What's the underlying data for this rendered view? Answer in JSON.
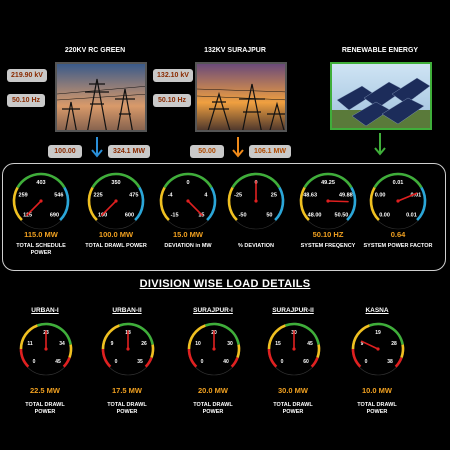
{
  "sources": [
    {
      "title": "220KV RC GREEN",
      "voltage": "219.90 kV",
      "frequency": "50.10 Hz",
      "flow_left": "100.00",
      "flow_right": "324.1 MW",
      "arrow_color": "#2a8fd8"
    },
    {
      "title": "132KV SURAJPUR",
      "voltage": "132.10 kV",
      "frequency": "50.10 Hz",
      "flow_left": "50.00",
      "flow_right": "106.1 MW",
      "arrow_color": "#f08a1a"
    },
    {
      "title": "RENEWABLE ENERGY",
      "arrow_color": "#3fae3a"
    }
  ],
  "summary_gauges": [
    {
      "ticks": [
        "403",
        "259",
        "546",
        "115",
        "690"
      ],
      "value": "115.0 MW",
      "label": "TOTAL SCHEDULE POWER",
      "fraction": 0.0
    },
    {
      "ticks": [
        "350",
        "225",
        "475",
        "100",
        "600"
      ],
      "value": "100.0 MW",
      "label": "TOTAL DRAWL POWER",
      "fraction": 0.0
    },
    {
      "ticks": [
        "0",
        "-4",
        "4",
        "-15",
        "15"
      ],
      "value": "15.0 MW",
      "label": "DEVIATION in MW",
      "fraction": 1.0
    },
    {
      "ticks": [
        "0",
        "-25",
        "25",
        "-50",
        "50"
      ],
      "value": "",
      "label": "% DEVIATION",
      "fraction": 0.5
    },
    {
      "ticks": [
        "49.25",
        "48.63",
        "49.88",
        "48.00",
        "50.50"
      ],
      "value": "50.10 HZ",
      "label": "SYSTEM FREQENCY",
      "fraction": 0.84
    },
    {
      "ticks": [
        "0.01",
        "0.00",
        "0.01",
        "0.00",
        "0.01"
      ],
      "value": "0.64",
      "label": "SYSTEM POWER FACTOR",
      "fraction": 0.75
    }
  ],
  "division": {
    "title": "DIVISION WISE LOAD DETAILS",
    "zones": [
      {
        "name": "URBAN-I",
        "ticks": [
          "23",
          "11",
          "34",
          "0",
          "45"
        ],
        "value": "22.5 MW",
        "label": "TOTAL DRAWL POWER",
        "fraction": 0.5
      },
      {
        "name": "URBAN-II",
        "ticks": [
          "18",
          "9",
          "26",
          "0",
          "35"
        ],
        "value": "17.5 MW",
        "label": "TOTAL DRAWL POWER",
        "fraction": 0.5
      },
      {
        "name": "SURAJPUR-I",
        "ticks": [
          "20",
          "10",
          "30",
          "0",
          "40"
        ],
        "value": "20.0 MW",
        "label": "TOTAL DRAWL POWER",
        "fraction": 0.5
      },
      {
        "name": "SURAJPUR-II",
        "ticks": [
          "30",
          "15",
          "45",
          "0",
          "60"
        ],
        "value": "30.0 MW",
        "label": "TOTAL DRAWL POWER",
        "fraction": 0.5
      },
      {
        "name": "KASNA",
        "ticks": [
          "19",
          "9",
          "28",
          "0",
          "38"
        ],
        "value": "10.0 MW",
        "label": "TOTAL DRAWL POWER",
        "fraction": 0.26
      }
    ]
  }
}
